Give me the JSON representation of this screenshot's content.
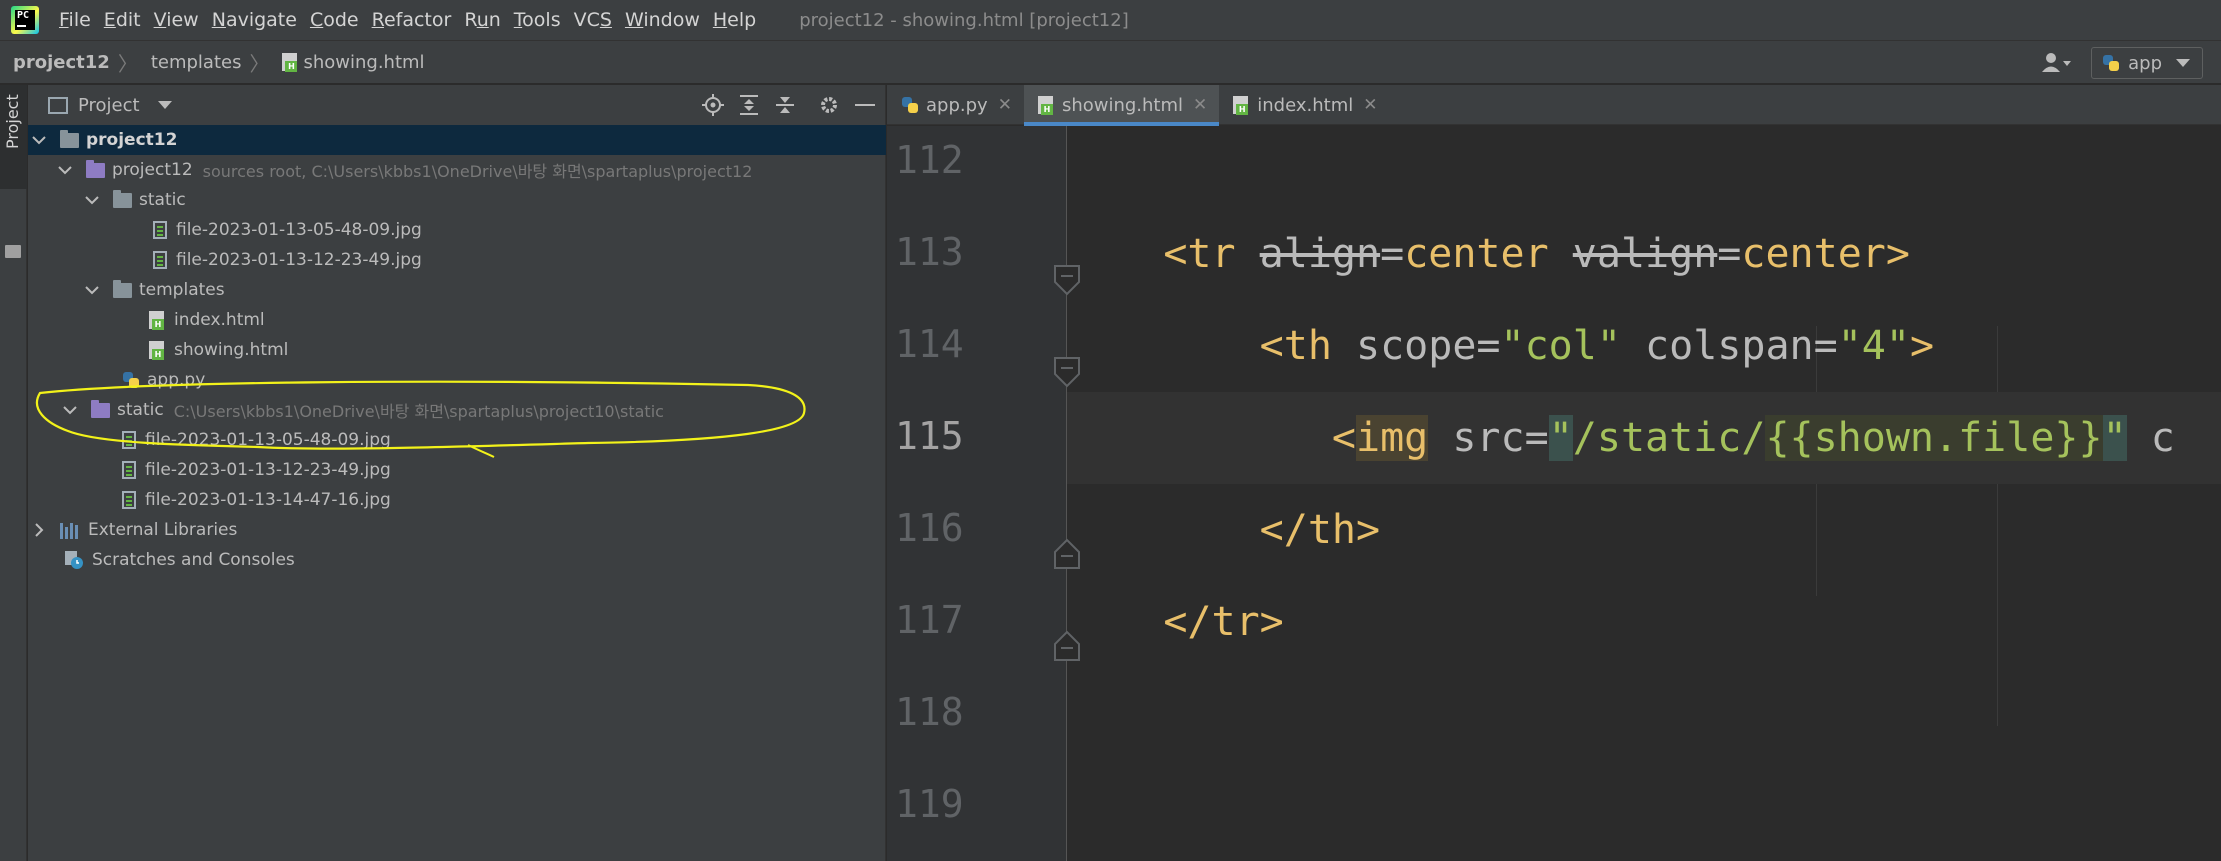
{
  "menubar": {
    "items": [
      {
        "mnemonic": "F",
        "rest": "ile"
      },
      {
        "mnemonic": "E",
        "rest": "dit"
      },
      {
        "mnemonic": "V",
        "rest": "iew"
      },
      {
        "mnemonic": "N",
        "rest": "avigate"
      },
      {
        "mnemonic": "C",
        "rest": "ode"
      },
      {
        "mnemonic": "R",
        "rest": "efactor"
      },
      {
        "pre": "R",
        "mnemonic": "u",
        "rest": "n"
      },
      {
        "mnemonic": "T",
        "rest": "ools"
      },
      {
        "pre": "VC",
        "mnemonic": "S",
        "rest": ""
      },
      {
        "mnemonic": "W",
        "rest": "indow"
      },
      {
        "mnemonic": "H",
        "rest": "elp"
      }
    ],
    "window_title": "project12 - showing.html [project12]"
  },
  "navbar": {
    "crumbs": [
      "project12",
      "templates",
      "showing.html"
    ],
    "run_config": "app"
  },
  "tool_strip": {
    "project_label": "Project"
  },
  "project_panel": {
    "title": "Project",
    "tree": [
      {
        "label": "project12"
      },
      {
        "label": "project12",
        "hint": "sources root,  C:\\Users\\kbbs1\\OneDrive\\바탕 화면\\spartaplus\\project12"
      },
      {
        "label": "static"
      },
      {
        "label": "file-2023-01-13-05-48-09.jpg"
      },
      {
        "label": "file-2023-01-13-12-23-49.jpg"
      },
      {
        "label": "templates"
      },
      {
        "label": "index.html"
      },
      {
        "label": "showing.html"
      },
      {
        "label": "app.py"
      },
      {
        "label": "static",
        "hint": "C:\\Users\\kbbs1\\OneDrive\\바탕 화면\\spartaplus\\project10\\static"
      },
      {
        "label": "file-2023-01-13-05-48-09.jpg"
      },
      {
        "label": "file-2023-01-13-12-23-49.jpg"
      },
      {
        "label": "file-2023-01-13-14-47-16.jpg"
      },
      {
        "label": "External Libraries"
      },
      {
        "label": "Scratches and Consoles"
      }
    ]
  },
  "editor_tabs": [
    {
      "label": "app.py"
    },
    {
      "label": "showing.html"
    },
    {
      "label": "index.html"
    }
  ],
  "editor": {
    "line_numbers": [
      "112",
      "113",
      "114",
      "115",
      "116",
      "117",
      "118",
      "119"
    ],
    "current_line": "115",
    "code": {
      "l113": {
        "open": "<tr",
        "attr1": "align",
        "eq1": "=",
        "val1": "center",
        "attr2": "valign",
        "eq2": "=",
        "val2": "center",
        "close": ">"
      },
      "l114": {
        "open": "<th",
        "attr1": "scope",
        "eq1": "=",
        "val1": "\"col\"",
        "attr2": "colspan",
        "eq2": "=",
        "val2": "\"4\"",
        "close": ">"
      },
      "l115": {
        "lt": "<",
        "tag": "img",
        "attr": "src",
        "eq": "=",
        "q1": "\"",
        "path": "/static/",
        "tmpl": "{{shown.file}}",
        "q2": "\"",
        "tail": " c"
      },
      "l116": {
        "text": "</th>"
      },
      "l117": {
        "text": "</tr>"
      }
    }
  },
  "colors": {
    "accent": "#4a88c7",
    "selection": "#0d293e",
    "annotation": "#f2f21a"
  }
}
